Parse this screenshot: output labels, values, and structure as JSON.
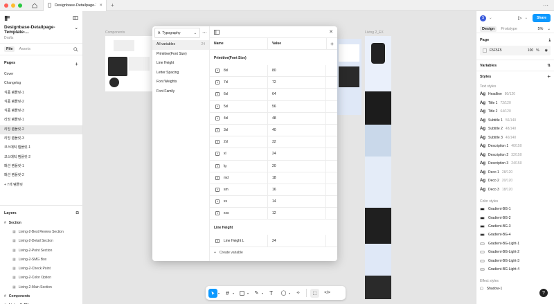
{
  "tab": {
    "title": "Designbase-Detailpage-Templat..."
  },
  "left": {
    "file_title": "Designbase-Detailpage-Template-...",
    "drafts": "Drafts",
    "tabs": [
      "File",
      "Assets"
    ],
    "pages_header": "Pages",
    "pages": [
      "Cover",
      "Changelog",
      "식품 템플릿-1",
      "식품 템플릿-2",
      "식품 템플릿-3",
      "리빙 템플릿-1",
      "리빙 템플릿-2",
      "리빙 템플릿-3",
      "코스메틱 템플릿-1",
      "코스메틱 템플릿-2",
      "패션 템플릿-1",
      "패션 템플릿-2",
      "+ 7개 템플릿"
    ],
    "selected_page_index": 6,
    "layers_header": "Layers",
    "layers": [
      {
        "label": "Section",
        "level": 0,
        "bold": true
      },
      {
        "label": "Living-2-Best Review Section",
        "level": 1
      },
      {
        "label": "Living-2-Detail Section",
        "level": 1
      },
      {
        "label": "Living-2-Point Section",
        "level": 1
      },
      {
        "label": "Living-2-SMG Box",
        "level": 1
      },
      {
        "label": "Living-2-Check Point",
        "level": 1
      },
      {
        "label": "Living-2-Color Option",
        "level": 1
      },
      {
        "label": "Living-2-Main Section",
        "level": 1
      },
      {
        "label": "Components",
        "level": 0,
        "bold": true
      },
      {
        "label": "Living 2_EX",
        "level": 0,
        "bold": true
      }
    ]
  },
  "canvas": {
    "label_left": "Components",
    "label_right": "Living 2_EX"
  },
  "modal": {
    "collection": "Typography",
    "groups": [
      {
        "label": "All variables",
        "count": "24"
      },
      {
        "label": "Primitive(Font Size)"
      },
      {
        "label": "Line Height"
      },
      {
        "label": "Letter Spacing"
      },
      {
        "label": "Font Weights"
      },
      {
        "label": "Font Family"
      }
    ],
    "col_name": "Name",
    "col_value": "Value",
    "group1_title": "Primitive(Font Size)",
    "rows": [
      {
        "name": "8xl",
        "value": "80"
      },
      {
        "name": "7xl",
        "value": "72"
      },
      {
        "name": "6xl",
        "value": "64"
      },
      {
        "name": "5xl",
        "value": "56"
      },
      {
        "name": "4xl",
        "value": "48"
      },
      {
        "name": "3xl",
        "value": "40"
      },
      {
        "name": "2xl",
        "value": "32"
      },
      {
        "name": "xl",
        "value": "24"
      },
      {
        "name": "lg",
        "value": "20"
      },
      {
        "name": "md",
        "value": "18"
      },
      {
        "name": "sm",
        "value": "16"
      },
      {
        "name": "xs",
        "value": "14"
      },
      {
        "name": "xxs",
        "value": "12"
      }
    ],
    "group2_title": "Line Height",
    "rows2": [
      {
        "name": "Line Height L",
        "value": "24"
      }
    ],
    "create_label": "Create variable"
  },
  "right": {
    "avatar": "S",
    "share": "Share",
    "tabs": [
      "Design",
      "Prototype"
    ],
    "zoom": "5%",
    "page_header": "Page",
    "page_color": "F5F5F5",
    "page_opacity": "100",
    "page_opacity_unit": "%",
    "variables_header": "Variables",
    "styles_header": "Styles",
    "text_styles_header": "Text styles",
    "text_styles": [
      {
        "name": "Headline",
        "meta": "80/120"
      },
      {
        "name": "Title 1",
        "meta": "72/120"
      },
      {
        "name": "Title 2",
        "meta": "64/120"
      },
      {
        "name": "Subtitle 1",
        "meta": "56/140"
      },
      {
        "name": "Subtitle 2",
        "meta": "48/140"
      },
      {
        "name": "Subtitle 3",
        "meta": "40/140"
      },
      {
        "name": "Description 1",
        "meta": "40/150"
      },
      {
        "name": "Description 2",
        "meta": "32/150"
      },
      {
        "name": "Description 3",
        "meta": "24/150"
      },
      {
        "name": "Deco 1",
        "meta": "28/120"
      },
      {
        "name": "Deco 2",
        "meta": "20/120"
      },
      {
        "name": "Deco 3",
        "meta": "18/120"
      }
    ],
    "color_styles_header": "Color styles",
    "color_styles": [
      {
        "name": "Gradient-BG-1",
        "color": "#111111"
      },
      {
        "name": "Gradient-BG-2",
        "color": "#1a1a1a"
      },
      {
        "name": "Gradient-BG-3",
        "color": "#2a2a2a"
      },
      {
        "name": "Gradient-BG-4",
        "color": "#333333"
      },
      {
        "name": "Gradient-BG-Light-1",
        "color": "#f2f2f2"
      },
      {
        "name": "Gradient-BG-Light-2",
        "color": "#eeeeee"
      },
      {
        "name": "Gradient-BG-Light-3",
        "color": "#e8e8e8"
      },
      {
        "name": "Gradient-BG-Light-4",
        "color": "#e2e2e2"
      }
    ],
    "effect_styles_header": "Effect styles",
    "effect_styles": [
      {
        "name": "Shadow-1"
      }
    ]
  }
}
